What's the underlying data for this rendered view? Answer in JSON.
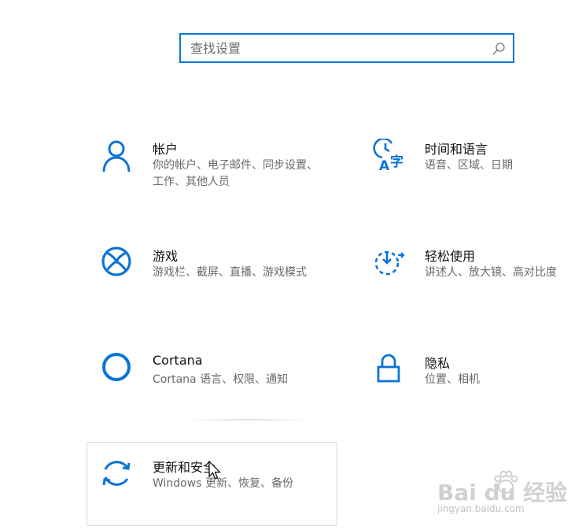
{
  "search": {
    "placeholder": "查找设置",
    "icon": "search-icon"
  },
  "accent": "#0a74d6",
  "tiles": [
    {
      "title": "帐户",
      "desc": "你的帐户、电子邮件、同步设置、工作、其他人员",
      "icon": "person-icon"
    },
    {
      "title": "时间和语言",
      "desc": "语音、区域、日期",
      "icon": "time-language-icon"
    },
    {
      "title": "游戏",
      "desc": "游戏栏、截屏、直播、游戏模式",
      "icon": "xbox-icon"
    },
    {
      "title": "轻松使用",
      "desc": "讲述人、放大镜、高对比度",
      "icon": "ease-of-access-icon"
    },
    {
      "title": "Cortana",
      "desc": "Cortana 语言、权限、通知",
      "icon": "cortana-icon"
    },
    {
      "title": "隐私",
      "desc": "位置、相机",
      "icon": "lock-icon"
    },
    {
      "title": "更新和安全",
      "desc": "Windows 更新、恢复、备份",
      "icon": "sync-icon"
    }
  ],
  "watermark": {
    "brand": "Bai du 经验",
    "url": "jingyan.baidu.com"
  }
}
